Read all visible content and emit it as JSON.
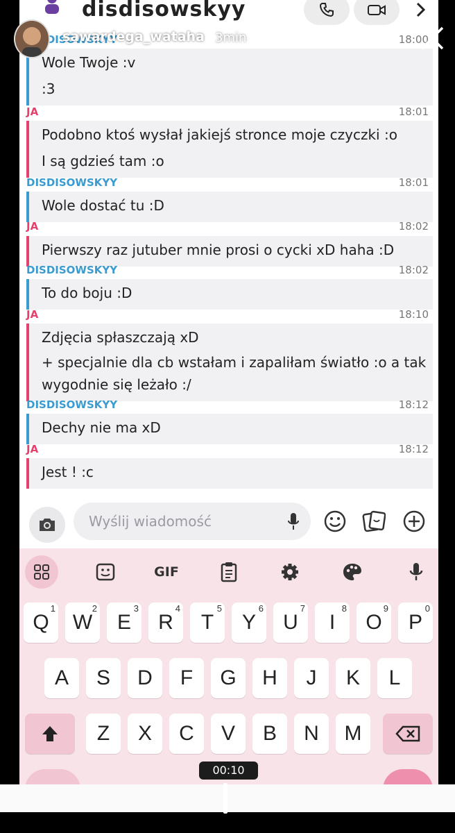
{
  "chat": {
    "title": "disdisowskyy"
  },
  "story": {
    "username": "sawardega_wataha",
    "time_ago": "3min",
    "video_time": "00:10"
  },
  "messages": [
    {
      "sender": "DISDISOWSKYY",
      "time": "18:00",
      "lines": [
        "Wole Twoje :v",
        ":3"
      ]
    },
    {
      "sender": "JA",
      "time": "18:01",
      "lines": [
        "Podobno ktoś wysłał jakiejś stronce moje czyczki :o",
        "I są gdzieś tam :o"
      ]
    },
    {
      "sender": "DISDISOWSKYY",
      "time": "18:01",
      "lines": [
        "Wole dostać tu :D"
      ]
    },
    {
      "sender": "JA",
      "time": "18:02",
      "lines": [
        "Pierwszy raz jutuber mnie prosi o cycki xD haha :D"
      ]
    },
    {
      "sender": "DISDISOWSKYY",
      "time": "18:02",
      "lines": [
        "To do boju :D"
      ]
    },
    {
      "sender": "JA",
      "time": "18:10",
      "lines": [
        "Zdjęcia spłaszczają xD",
        "+ specjalnie dla cb wstałam i zapaliłam światło :o a tak",
        "wygodnie się leżało :/"
      ]
    },
    {
      "sender": "DISDISOWSKYY",
      "time": "18:12",
      "lines": [
        "Dechy nie ma xD"
      ]
    },
    {
      "sender": "JA",
      "time": "18:12",
      "lines": [
        "Jest ! :c"
      ]
    }
  ],
  "composer": {
    "placeholder": "Wyślij wiadomość"
  },
  "keyboard": {
    "gif_label": "GIF",
    "row1": [
      "Q",
      "W",
      "E",
      "R",
      "T",
      "Y",
      "U",
      "I",
      "O",
      "P"
    ],
    "row1_hints": [
      "1",
      "2",
      "3",
      "4",
      "5",
      "6",
      "7",
      "8",
      "9",
      "0"
    ],
    "row2": [
      "A",
      "S",
      "D",
      "F",
      "G",
      "H",
      "J",
      "K",
      "L"
    ],
    "row3": [
      "Z",
      "X",
      "C",
      "V",
      "B",
      "N",
      "M"
    ]
  },
  "icons": {
    "story_close": "close-icon",
    "phone": "phone-icon",
    "video": "video-call-icon",
    "chevron": "chevron-right-icon",
    "camera": "camera-icon",
    "mic": "microphone-icon",
    "emoji": "emoji-icon",
    "sticker": "sticker-icon",
    "plus": "plus-icon",
    "grid": "apps-grid-icon",
    "clipboard": "clipboard-icon",
    "settings": "gear-icon",
    "palette": "palette-icon",
    "shift": "shift-icon",
    "backspace": "backspace-icon"
  },
  "colors": {
    "me_accent": "#e5416d",
    "them_accent": "#3a9bd0",
    "keyboard_bg": "#f7e3e8"
  }
}
